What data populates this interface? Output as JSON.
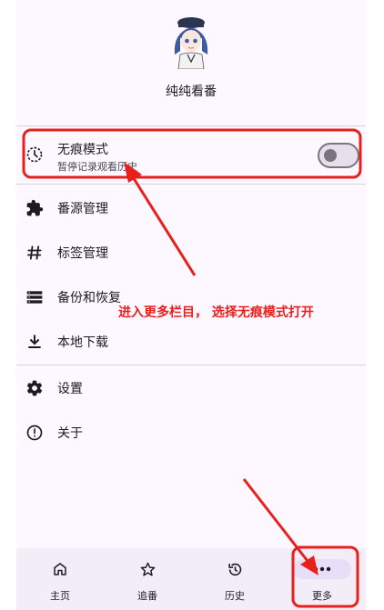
{
  "app": {
    "name": "纯纯看番"
  },
  "menu": {
    "incognito": {
      "title": "无痕模式",
      "subtitle": "暂停记录观看历史",
      "enabled": false
    },
    "items": [
      {
        "label": "番源管理",
        "icon": "puzzle-icon"
      },
      {
        "label": "标签管理",
        "icon": "hashtag-icon"
      },
      {
        "label": "备份和恢复",
        "icon": "storage-icon"
      },
      {
        "label": "本地下载",
        "icon": "download-icon"
      }
    ],
    "settings": [
      {
        "label": "设置",
        "icon": "gear-icon"
      },
      {
        "label": "关于",
        "icon": "info-icon"
      }
    ]
  },
  "nav": {
    "items": [
      {
        "label": "主页",
        "icon": "home-icon"
      },
      {
        "label": "追番",
        "icon": "star-icon"
      },
      {
        "label": "历史",
        "icon": "history-icon"
      },
      {
        "label": "更多",
        "icon": "more-icon",
        "active": true
      }
    ]
  },
  "annotation": {
    "text": "进入更多栏目， 选择无痕模式打开",
    "color": "#e8201c"
  }
}
